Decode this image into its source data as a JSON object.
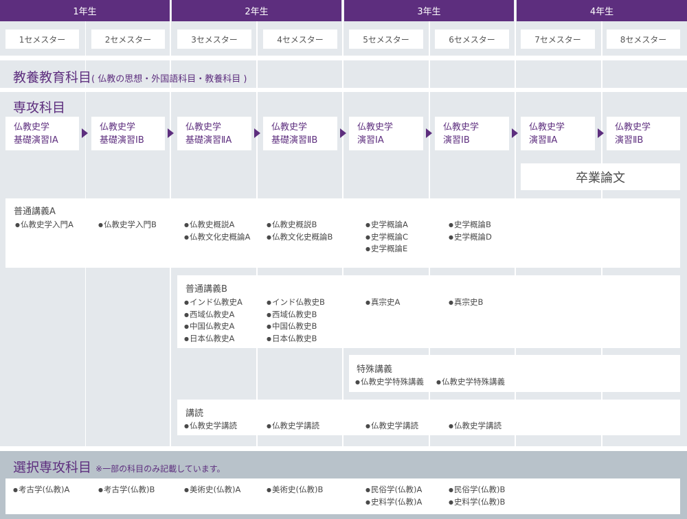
{
  "years": [
    "1年生",
    "2年生",
    "3年生",
    "4年生"
  ],
  "semesters": [
    "1セメスター",
    "2セメスター",
    "3セメスター",
    "4セメスター",
    "5セメスター",
    "6セメスター",
    "7セメスター",
    "8セメスター"
  ],
  "general_ed": {
    "title": "教養教育科目",
    "subtitle": "( 仏教の思想・外国語科目・教養科目 )"
  },
  "major": {
    "title": "専攻科目",
    "seminars": [
      {
        "line1": "仏教史学",
        "line2": "基礎演習ⅠA"
      },
      {
        "line1": "仏教史学",
        "line2": "基礎演習ⅠB"
      },
      {
        "line1": "仏教史学",
        "line2": "基礎演習ⅡA"
      },
      {
        "line1": "仏教史学",
        "line2": "基礎演習ⅡB"
      },
      {
        "line1": "仏教史学",
        "line2": "演習ⅠA"
      },
      {
        "line1": "仏教史学",
        "line2": "演習ⅠB"
      },
      {
        "line1": "仏教史学",
        "line2": "演習ⅡA"
      },
      {
        "line1": "仏教史学",
        "line2": "演習ⅡB"
      }
    ],
    "thesis": "卒業論文"
  },
  "lectures_a": {
    "title": "普通講義A",
    "columns": [
      [
        "仏教史学入門A"
      ],
      [
        "仏教史学入門B"
      ],
      [
        "仏教史概説A",
        "仏教文化史概論A"
      ],
      [
        "仏教史概説B",
        "仏教文化史概論B"
      ],
      [
        "史学概論A",
        "史学概論C",
        "史学概論E"
      ],
      [
        "史学概論B",
        "史学概論D"
      ]
    ]
  },
  "lectures_b": {
    "title": "普通講義B",
    "columns": [
      [
        "インド仏教史A",
        "西域仏教史A",
        "中国仏教史A",
        "日本仏教史A"
      ],
      [
        "インド仏教史B",
        "西域仏教史B",
        "中国仏教史B",
        "日本仏教史B"
      ],
      [
        "真宗史A"
      ],
      [
        "真宗史B"
      ]
    ]
  },
  "special": {
    "title": "特殊講義",
    "columns": [
      [
        "仏教史学特殊講義"
      ],
      [
        "仏教史学特殊講義"
      ]
    ]
  },
  "reading": {
    "title": "講読",
    "columns": [
      [
        "仏教史学講読"
      ],
      [
        "仏教史学講読"
      ],
      [
        "仏教史学講読"
      ],
      [
        "仏教史学講読"
      ]
    ]
  },
  "elective": {
    "title": "選択専攻科目",
    "note": "※一部の科目のみ記載しています。",
    "columns": [
      [
        "考古学(仏教)A"
      ],
      [
        "考古学(仏教)B"
      ],
      [
        "美術史(仏教)A"
      ],
      [
        "美術史(仏教)B"
      ],
      [
        "民俗学(仏教)A",
        "史料学(仏教)A"
      ],
      [
        "民俗学(仏教)B",
        "史料学(仏教)B"
      ]
    ]
  },
  "colors": {
    "accent": "#5d2e7e",
    "column_bg": "#e4e8ec",
    "elective_bg": "#b8c2ca"
  }
}
